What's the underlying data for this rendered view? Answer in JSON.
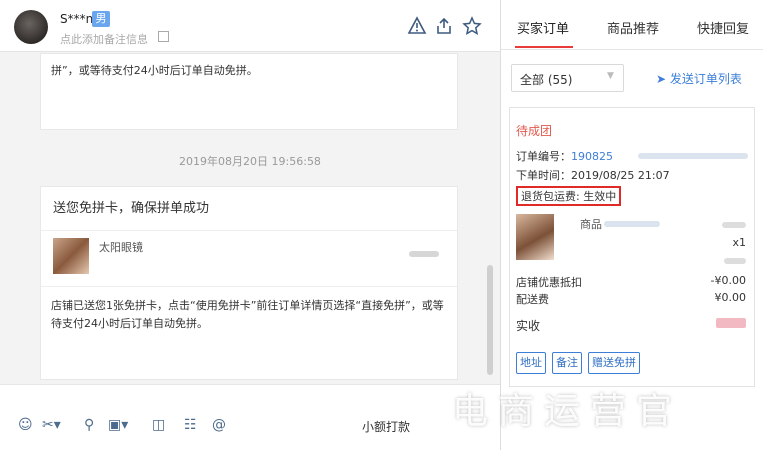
{
  "header": {
    "username": "S***n",
    "gender_badge": "男",
    "remark_placeholder": "点此添加备注信息",
    "icons": [
      "warning-icon",
      "share-icon",
      "star-icon"
    ]
  },
  "chat": {
    "card1_text": "拼”，或等待支付24小时后订单自动免拼。",
    "timestamp": "2019年08月20日 19:56:58",
    "card2_title": "送您免拼卡，确保拼单成功",
    "card2_product": "太阳眼镜",
    "card2_text": "店铺已送您1张免拼卡，点击“使用免拼卡”前往订单详情页选择“直接免拼”，或等待支付24小时后订单自动免拼。"
  },
  "toolbar": {
    "icons": [
      "emoji-icon",
      "scissors-icon",
      "link-icon",
      "image-icon",
      "video-icon",
      "file-icon",
      "at-icon"
    ],
    "small_pay": "小额打款"
  },
  "right": {
    "tabs": [
      "买家订单",
      "商品推荐",
      "快捷回复"
    ],
    "filter": "全部 (55)",
    "send_list": "发送订单列表",
    "order": {
      "status": "待成团",
      "order_no_label": "订单编号：",
      "order_no": "190825",
      "time": "下单时间：2019/08/25 21:07",
      "freight": "退货包运费: 生效中",
      "product_name": "商品",
      "qty": "x1",
      "discount_label": "店铺优惠抵扣",
      "discount_value": "-¥0.00",
      "shipping_label": "配送费",
      "shipping_value": "¥0.00",
      "paid_label": "实收",
      "buttons": [
        "地址",
        "备注",
        "赠送免拼"
      ]
    }
  },
  "watermark": "电商运营官"
}
